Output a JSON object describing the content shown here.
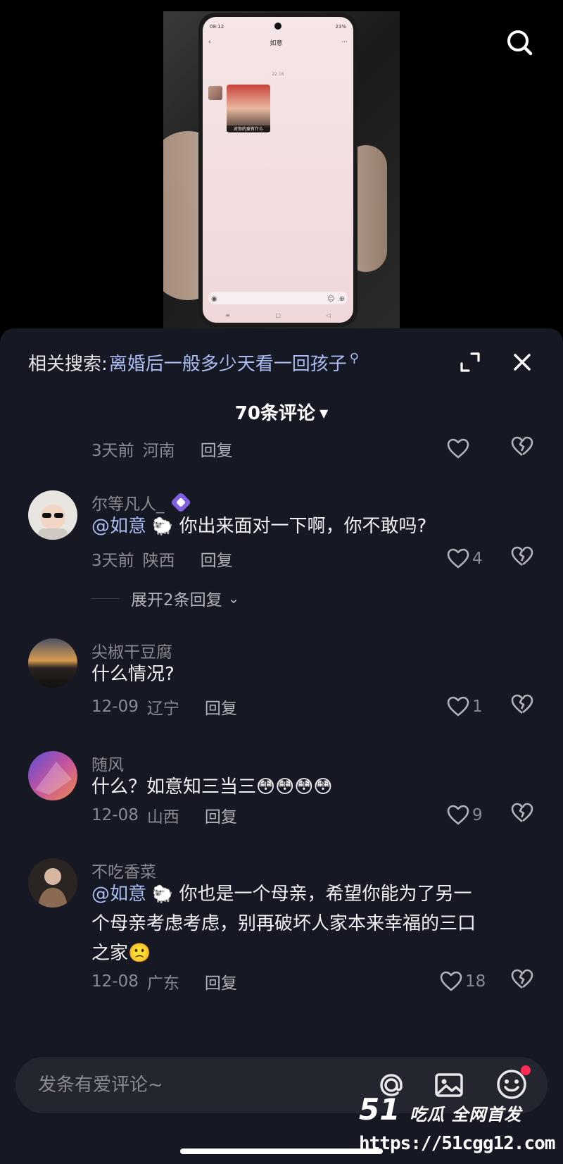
{
  "photo": {
    "phone_status_time": "08:12",
    "phone_battery": "23%",
    "phone_chat_title": "如意",
    "phone_timestamp": "22:16",
    "phone_sticker_caption": "对你的爱有什么",
    "search_icon": "search-icon"
  },
  "sheet": {
    "related_label": "相关搜索:",
    "related_query": "离婚后一般多少天看一回孩子",
    "comment_count": "70条评论",
    "input_placeholder": "发条有爱评论~"
  },
  "comments": [
    {
      "username": "",
      "text": "",
      "date": "3天前",
      "region": "河南",
      "reply_label": "回复",
      "likes": ""
    },
    {
      "username": "尔等凡人_",
      "mention": "@如意",
      "text": "你出来面对一下啊，你不敢吗?",
      "date": "3天前",
      "region": "陕西",
      "reply_label": "回复",
      "likes": "4",
      "expand_replies": "展开2条回复"
    },
    {
      "username": "尖椒干豆腐",
      "text": "什么情况?",
      "date": "12-09",
      "region": "辽宁",
      "reply_label": "回复",
      "likes": "1"
    },
    {
      "username": "随风",
      "text": "什么？如意知三当三😳😳😳😳",
      "date": "12-08",
      "region": "山西",
      "reply_label": "回复",
      "likes": "9"
    },
    {
      "username": "不吃香菜",
      "mention": "@如意",
      "text_line1": "你也是一个母亲，希望你能为了另一",
      "text_line2": "个母亲考虑考虑，别再破坏人家本来幸福的三口",
      "text_line3": "之家🙁",
      "date": "12-08",
      "region": "广东",
      "reply_label": "回复",
      "likes": "18"
    }
  ],
  "watermark": {
    "number": "51",
    "brand": "吃瓜 全网首发",
    "url": "https://51cgg12.com"
  },
  "colors": {
    "sheet_bg": "#161823",
    "mention": "#a9bdf2",
    "meta_gray": "#8a8b91",
    "notify_dot": "#fe2c55",
    "badge": "#7e60e0"
  }
}
